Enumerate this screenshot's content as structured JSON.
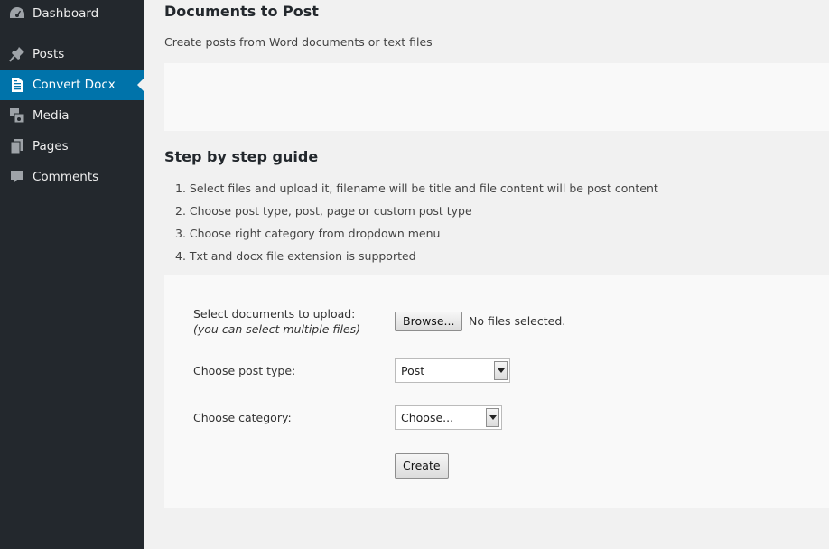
{
  "sidebar": {
    "items": [
      {
        "label": "Dashboard",
        "icon": "dashboard-icon"
      },
      {
        "label": "Posts",
        "icon": "pin-icon"
      },
      {
        "label": "Convert Docx",
        "icon": "document-icon",
        "active": true
      },
      {
        "label": "Media",
        "icon": "media-icon"
      },
      {
        "label": "Pages",
        "icon": "pages-icon"
      },
      {
        "label": "Comments",
        "icon": "comment-icon"
      }
    ]
  },
  "main": {
    "title": "Documents to Post",
    "description": "Create posts from Word documents or text files",
    "guide": {
      "title": "Step by step guide",
      "steps": [
        "1. Select files and upload it, filename will be title and file content will be post content",
        "2. Choose post type, post, page or custom post type",
        "3. Choose right category from dropdown menu",
        "4. Txt and docx file extension is supported"
      ]
    },
    "form": {
      "upload_label": "Select documents to upload:",
      "upload_hint": "(you can select multiple files)",
      "browse_label": "Browse...",
      "file_status": "No files selected.",
      "post_type_label": "Choose post type:",
      "post_type_value": "Post",
      "category_label": "Choose category:",
      "category_value": "Choose...",
      "create_label": "Create"
    }
  },
  "colors": {
    "sidebar_bg": "#23282d",
    "active_bg": "#0073aa",
    "page_bg": "#f1f1f1",
    "panel_bg": "#f9f9f9"
  }
}
